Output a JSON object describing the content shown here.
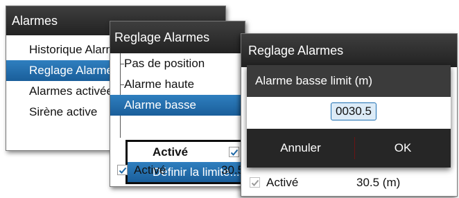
{
  "window1": {
    "title": "Alarmes",
    "items": [
      "Historique Alarmes",
      "Reglage Alarmes",
      "Alarmes activées",
      "Sirène active"
    ],
    "selected_index": 1
  },
  "window2": {
    "title": "Reglage Alarmes",
    "items": [
      "Pas de position",
      "Alarme haute",
      "Alarme basse"
    ],
    "selected_index": 2,
    "popup": {
      "active_label": "Activé",
      "active_checked": true,
      "define_label": "Définir la limite..."
    },
    "footer": {
      "label": "Activé",
      "value": "30.5",
      "checked": true
    }
  },
  "window3": {
    "title": "Reglage Alarmes",
    "footer": {
      "label": "Activé",
      "value": "30.5 (m)",
      "checked": true
    }
  },
  "dialog": {
    "title": "Alarme basse limit (m)",
    "value": "0030.5",
    "cancel_label": "Annuler",
    "ok_label": "OK"
  },
  "colors": {
    "selection": "#1f6aa8",
    "title_bar": "#2a2a2a",
    "dialog_bg": "#262626"
  }
}
